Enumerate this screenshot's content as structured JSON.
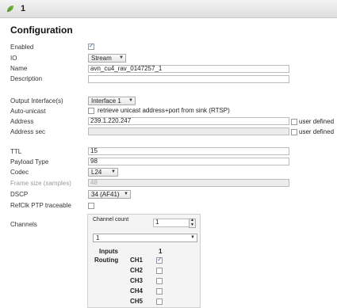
{
  "header": {
    "number": "1"
  },
  "title": "Configuration",
  "fields": {
    "enabled_label": "Enabled",
    "enabled_checked": true,
    "io_label": "IO",
    "io_value": "Stream",
    "name_label": "Name",
    "name_value": "avn_cu4_rav_0147257_1",
    "description_label": "Description",
    "description_value": "",
    "output_interface_label": "Output Interface(s)",
    "output_interface_value": "Interface 1",
    "auto_unicast_label": "Auto-unicast",
    "auto_unicast_text": "retrieve unicast address+port from sink (RTSP)",
    "auto_unicast_checked": false,
    "address_label": "Address",
    "address_value": "239.1.220.247",
    "address_user_defined": "user defined",
    "address_sec_label": "Address sec",
    "address_sec_value": "",
    "address_sec_user_defined": "user defined",
    "ttl_label": "TTL",
    "ttl_value": "15",
    "payload_type_label": "Payload Type",
    "payload_type_value": "98",
    "codec_label": "Codec",
    "codec_value": "L24",
    "frame_size_label": "Frame size (samples)",
    "frame_size_value": "48",
    "dscp_label": "DSCP",
    "dscp_value": "34 (AF41)",
    "refclk_label": "RefClk PTP traceable",
    "refclk_checked": false,
    "channels_label": "Channels"
  },
  "channels": {
    "count_label": "Channel count",
    "count_value": "1",
    "select_value": "1",
    "inputs_label": "Inputs",
    "inputs_col": "1",
    "routing_label": "Routing",
    "rows": [
      {
        "name": "CH1",
        "checked": true
      },
      {
        "name": "CH2",
        "checked": false
      },
      {
        "name": "CH3",
        "checked": false
      },
      {
        "name": "CH4",
        "checked": false
      },
      {
        "name": "CH5",
        "checked": false
      }
    ]
  },
  "colors": {
    "accent": "#2a6ad0",
    "leaf": "#6cae3a"
  },
  "icons": {
    "header": "leaf-icon",
    "dropdown": "chevron-down-icon"
  }
}
